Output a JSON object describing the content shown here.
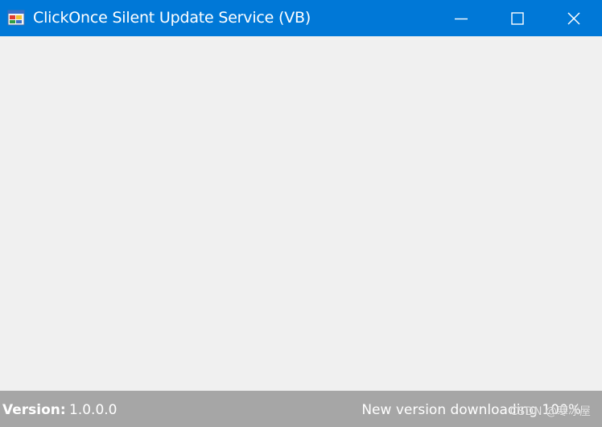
{
  "window": {
    "title": "ClickOnce Silent Update Service (VB)",
    "title_bar_color": "#0078d7",
    "background_color": "#f0f0f0"
  },
  "icons": {
    "app": "application-window-icon",
    "minimize": "minimize-icon",
    "maximize": "maximize-icon",
    "close": "close-icon"
  },
  "status_bar": {
    "version_label": "Version:",
    "version_value": "1.0.0.0",
    "message": "New version downloading 100%",
    "background_color": "#a6a6a6"
  },
  "watermark": {
    "text": "CSDN @寒冰屋"
  }
}
